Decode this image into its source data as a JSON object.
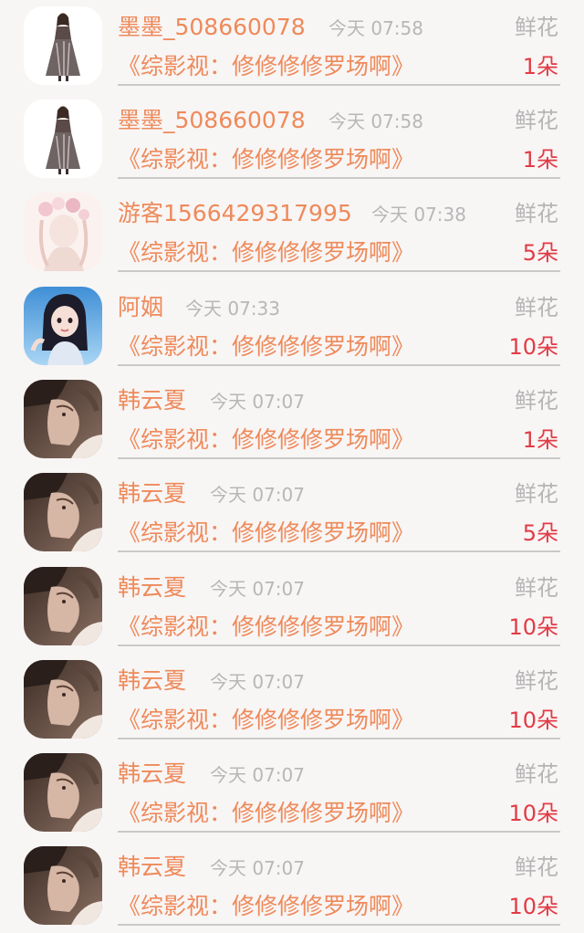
{
  "gifts": [
    {
      "name": "墨墨_508660078",
      "time": "今天 07:58",
      "gift": "鲜花",
      "book": "《综影视：修修修修罗场啊》",
      "count": "1朵",
      "avatar": "girl-dress-avatar"
    },
    {
      "name": "墨墨_508660078",
      "time": "今天 07:58",
      "gift": "鲜花",
      "book": "《综影视：修修修修罗场啊》",
      "count": "1朵",
      "avatar": "girl-dress-avatar"
    },
    {
      "name": "游客1566429317995",
      "time": "今天 07:38",
      "gift": "鲜花",
      "book": "《综影视：修修修修罗场啊》",
      "count": "5朵",
      "avatar": "flower-crown-avatar"
    },
    {
      "name": "阿姻",
      "time": "今天 07:33",
      "gift": "鲜花",
      "book": "《综影视：修修修修罗场啊》",
      "count": "10朵",
      "avatar": "anime-girl-avatar"
    },
    {
      "name": "韩云夏",
      "time": "今天 07:07",
      "gift": "鲜花",
      "book": "《综影视：修修修修罗场啊》",
      "count": "1朵",
      "avatar": "portrait-avatar"
    },
    {
      "name": "韩云夏",
      "time": "今天 07:07",
      "gift": "鲜花",
      "book": "《综影视：修修修修罗场啊》",
      "count": "5朵",
      "avatar": "portrait-avatar"
    },
    {
      "name": "韩云夏",
      "time": "今天 07:07",
      "gift": "鲜花",
      "book": "《综影视：修修修修罗场啊》",
      "count": "10朵",
      "avatar": "portrait-avatar"
    },
    {
      "name": "韩云夏",
      "time": "今天 07:07",
      "gift": "鲜花",
      "book": "《综影视：修修修修罗场啊》",
      "count": "10朵",
      "avatar": "portrait-avatar"
    },
    {
      "name": "韩云夏",
      "time": "今天 07:07",
      "gift": "鲜花",
      "book": "《综影视：修修修修罗场啊》",
      "count": "10朵",
      "avatar": "portrait-avatar"
    },
    {
      "name": "韩云夏",
      "time": "今天 07:07",
      "gift": "鲜花",
      "book": "《综影视：修修修修罗场啊》",
      "count": "10朵",
      "avatar": "portrait-avatar"
    }
  ],
  "colors": {
    "name": "#ee8a5a",
    "count": "#e23b45",
    "muted": "#b5b5b5",
    "background": "#f8f5f5"
  }
}
